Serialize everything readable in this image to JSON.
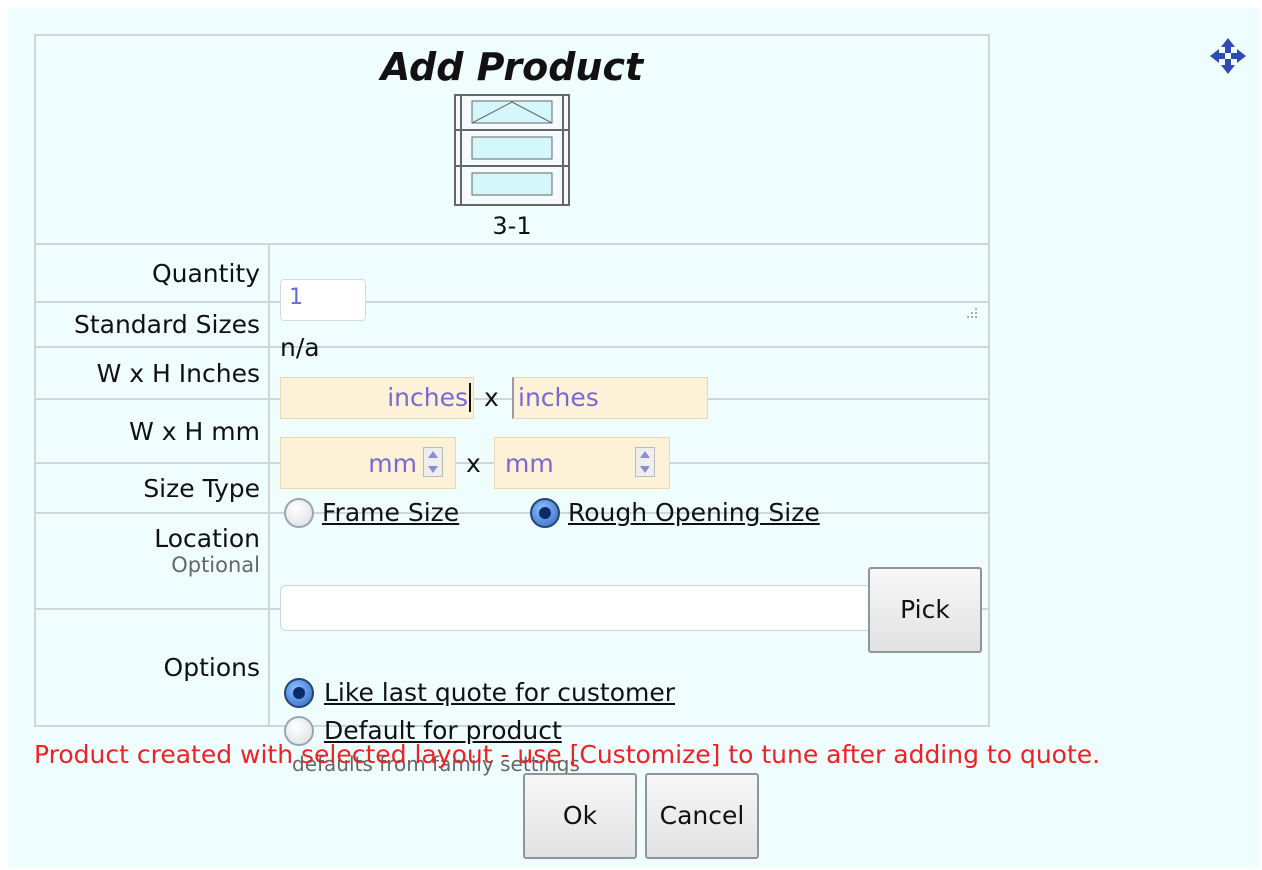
{
  "title": "Add Product",
  "product": {
    "code": "3-1"
  },
  "quantity": {
    "label": "Quantity",
    "value": "1"
  },
  "standard_sizes": {
    "label": "Standard Sizes",
    "value": "n/a"
  },
  "inches": {
    "label": "W x H Inches",
    "width_placeholder": "inches",
    "separator": "x",
    "height_placeholder": "inches"
  },
  "mm": {
    "label": "W x H mm",
    "width_placeholder": "mm",
    "separator": "x",
    "height_placeholder": "mm"
  },
  "size_type": {
    "label": "Size Type",
    "options": [
      "Frame Size",
      "Rough Opening Size"
    ],
    "selected": "Rough Opening Size"
  },
  "location": {
    "label": "Location",
    "sublabel": "Optional",
    "value": "",
    "pick_label": "Pick"
  },
  "options": {
    "label": "Options",
    "choices": [
      "Like last quote for customer",
      "Default for product"
    ],
    "selected": "Like last quote for customer",
    "hint": "defaults from family settings"
  },
  "message": "Product created with selected layout - use [Customize] to tune after adding to quote.",
  "buttons": {
    "ok": "Ok",
    "cancel": "Cancel"
  },
  "colors": {
    "background": "#f0fdfe",
    "input_highlight": "#fdf1d8",
    "message": "#ee2222",
    "placeholder": "#7b68d8",
    "move_icon": "#2e4ab3"
  },
  "icons": {
    "move": "move-arrows-icon",
    "resize": "resize-grip-icon"
  }
}
